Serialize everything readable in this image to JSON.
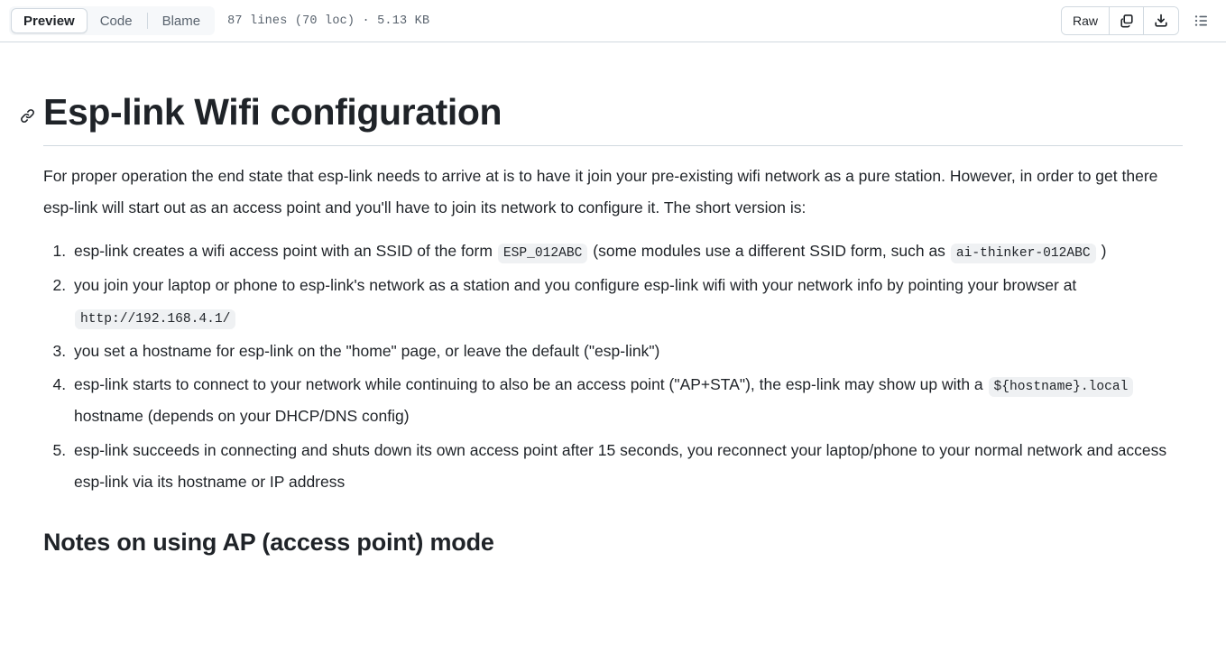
{
  "header": {
    "tabs": [
      {
        "label": "Preview",
        "active": true
      },
      {
        "label": "Code",
        "active": false
      },
      {
        "label": "Blame",
        "active": false
      }
    ],
    "file_meta": "87 lines (70 loc) · 5.13 KB",
    "raw_label": "Raw",
    "copy_icon": "copy-icon",
    "download_icon": "download-icon",
    "toc_icon": "table-of-contents-icon"
  },
  "document": {
    "h1": "Esp-link Wifi configuration",
    "anchor_icon": "link-icon",
    "intro": "For proper operation the end state that esp-link needs to arrive at is to have it join your pre-existing wifi network as a pure station. However, in order to get there esp-link will start out as an access point and you'll have to join its network to configure it. The short version is:",
    "steps": [
      {
        "before": "esp-link creates a wifi access point with an SSID of the form ",
        "code1": "ESP_012ABC",
        "middle": " (some modules use a different SSID form, such as ",
        "code2": "ai-thinker-012ABC",
        "after": " )"
      },
      {
        "before": "you join your laptop or phone to esp-link's network as a station and you configure esp-link wifi with your network info by pointing your browser at ",
        "code1": "http://192.168.4.1/",
        "middle": "",
        "code2": "",
        "after": ""
      },
      {
        "before": "you set a hostname for esp-link on the \"home\" page, or leave the default (\"esp-link\")",
        "code1": "",
        "middle": "",
        "code2": "",
        "after": ""
      },
      {
        "before": "esp-link starts to connect to your network while continuing to also be an access point (\"AP+STA\"), the esp-link may show up with a ",
        "code1": "${hostname}.local",
        "middle": "",
        "code2": "",
        "after": " hostname (depends on your DHCP/DNS config)"
      },
      {
        "before": "esp-link succeeds in connecting and shuts down its own access point after 15 seconds, you reconnect your laptop/phone to your normal network and access esp-link via its hostname or IP address",
        "code1": "",
        "middle": "",
        "code2": "",
        "after": ""
      }
    ],
    "h2": "Notes on using AP (access point) mode"
  },
  "colors": {
    "border": "#d1d9e0",
    "muted_text": "#59636e",
    "code_bg": "#eff1f3",
    "tab_bg": "#f6f8fa",
    "text": "#1f2328"
  }
}
